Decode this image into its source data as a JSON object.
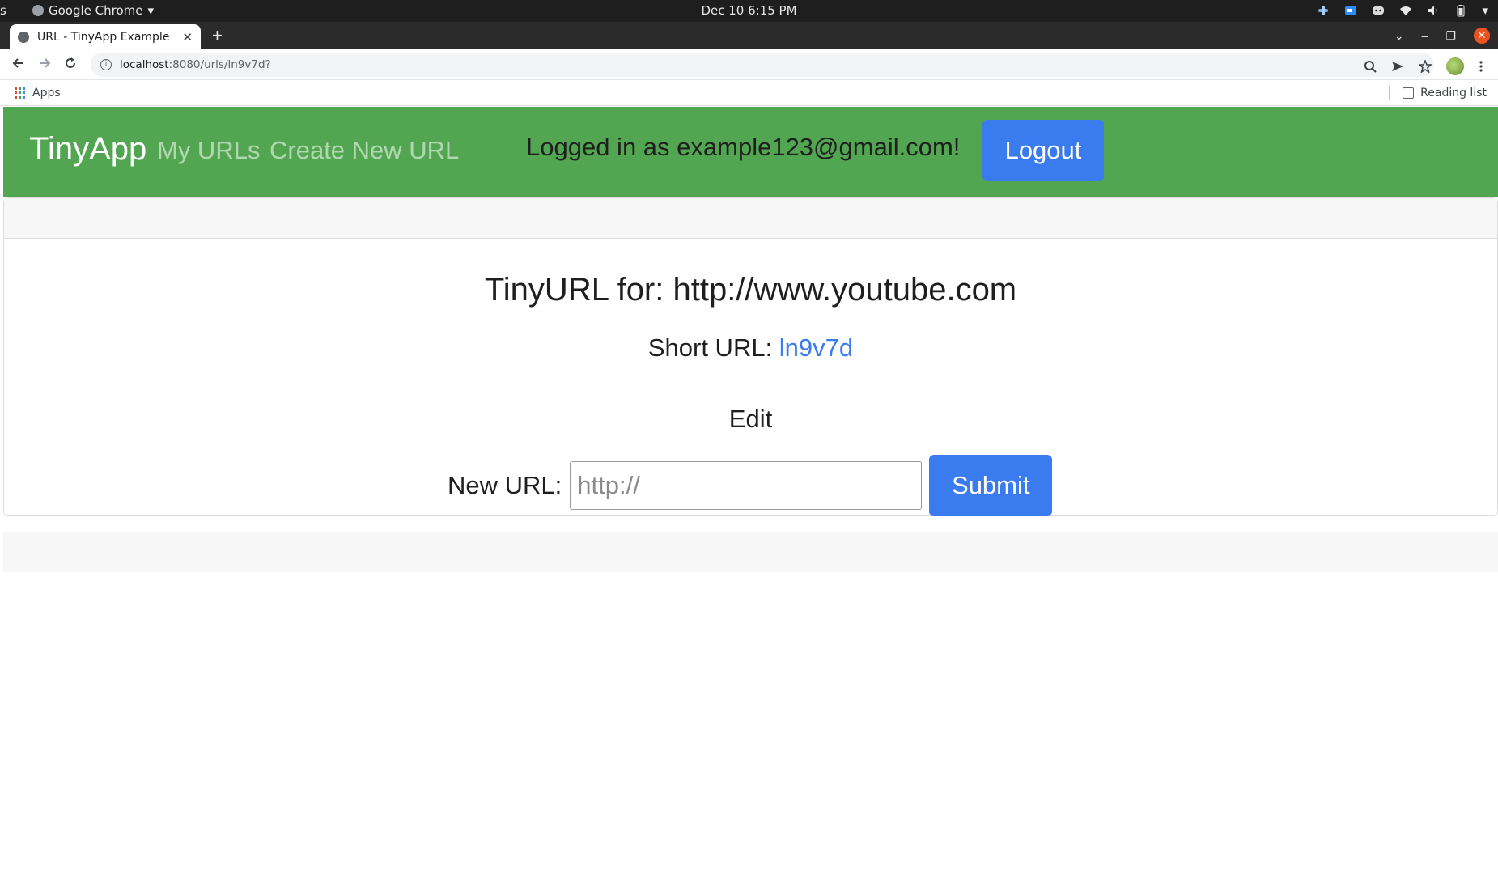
{
  "system_bar": {
    "left_edge": "s",
    "app_name": "Google Chrome",
    "app_menu_arrow": "▾",
    "clock": "Dec 10  6:15 PM",
    "tray_menu_arrow": "▾"
  },
  "browser": {
    "tab_title": "URL - TinyApp Example",
    "tab_close": "✕",
    "new_tab": "+",
    "url_host": "localhost",
    "url_path": ":8080/urls/ln9v7d?",
    "bookmarks": {
      "apps_label": "Apps",
      "reading_list_label": "Reading list"
    },
    "window_controls": {
      "tab_search": "⌄",
      "minimize": "–",
      "restore": "❐",
      "close": "✕"
    }
  },
  "navbar": {
    "brand": "TinyApp",
    "links": [
      "My URLs",
      "Create New URL"
    ],
    "logged_in_text": "Logged in as example123@gmail.com!",
    "logout_label": "Logout",
    "colors": {
      "background": "#53a651",
      "button": "#3a7bf0"
    }
  },
  "main": {
    "title": "TinyURL for: http://www.youtube.com",
    "short_url_label": "Short URL: ",
    "short_url_value": "ln9v7d",
    "edit_heading": "Edit",
    "form": {
      "label": "New URL:",
      "input_placeholder": "http://",
      "input_value": "",
      "submit_label": "Submit"
    }
  }
}
